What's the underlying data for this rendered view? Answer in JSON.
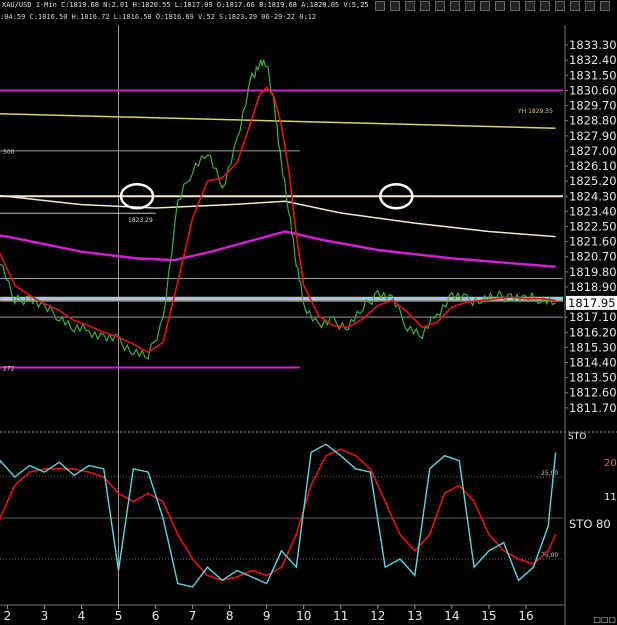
{
  "toolbar": {
    "header": "XAU/USD  1-Min  C:1819.68  N:2.01  H:1820.55  L:1817.09  O:1817.66  B:1819.68  A:1820.05  V:5,25",
    "icons": [
      "wave-icon",
      "check-icon",
      "bars-icon",
      "down-arrow-icon",
      "stop-icon",
      "zoom-icon",
      "pencil-icon",
      "pencil-icon",
      "flag-icon",
      "question-icon",
      "help-icon",
      "pencil-icon",
      "box-icon",
      "crosshair-icon",
      "grid-icon",
      "window-icon"
    ]
  },
  "info_line": ":04:59  C:1816.50  H:1816.72  L:1816.50  O:1816.69  V:52  S:1823.29  06-29-22  0:12",
  "right_boxes": "□□□",
  "colors": {
    "background": "#000000",
    "price": "#3fae3f",
    "price_ma": "#e01515",
    "magenta": "#d020d0",
    "yellow": "#d8d26a",
    "cream": "#f2e9c8",
    "light_blue": "#9cc8e8",
    "orange": "#e0702a",
    "cyan": "#5fd4e0",
    "label_box": "#ffffff"
  },
  "chart_data": {
    "type": "line",
    "symbol": "XAU/USD 1-Min",
    "price_panel": {
      "ylim": [
        1810.5,
        1834.2
      ],
      "ytick_labels": [
        "1833.30",
        "1832.40",
        "1831.50",
        "1830.60",
        "1829.70",
        "1828.80",
        "1827.90",
        "1827.00",
        "1826.10",
        "1825.20",
        "1824.30",
        "1823.40",
        "1822.50",
        "1821.60",
        "1820.70",
        "1819.80",
        "1818.90",
        "1817.10",
        "1816.20",
        "1815.30",
        "1814.40",
        "1813.50",
        "1812.60",
        "1811.70"
      ],
      "current_price_label": "1817.95",
      "current_price": 1817.95,
      "price_series": {
        "x": [
          1.4,
          1.8,
          2.2,
          2.6,
          3.0,
          3.4,
          3.8,
          4.2,
          4.6,
          5.0,
          5.4,
          5.8,
          6.2,
          6.6,
          7.0,
          7.4,
          7.8,
          8.2,
          8.6,
          8.8,
          9.0,
          9.2,
          9.4,
          9.6,
          9.8,
          10.0,
          10.4,
          10.8,
          11.2,
          11.6,
          12.0,
          12.4,
          12.8,
          13.2,
          13.6,
          14.0,
          14.4,
          14.8,
          15.2,
          15.6,
          16.0,
          16.4,
          16.8
        ],
        "values": [
          1822.3,
          1820.5,
          1818.0,
          1818.3,
          1817.6,
          1817.2,
          1816.4,
          1816.3,
          1815.9,
          1815.7,
          1815.1,
          1814.7,
          1817.0,
          1823.8,
          1826.0,
          1826.9,
          1824.8,
          1827.6,
          1831.3,
          1832.3,
          1832.1,
          1829.9,
          1826.0,
          1823.6,
          1820.3,
          1817.9,
          1816.6,
          1816.8,
          1816.6,
          1817.6,
          1818.6,
          1818.1,
          1816.6,
          1816.0,
          1817.3,
          1818.4,
          1818.1,
          1818.2,
          1818.3,
          1818.4,
          1818.1,
          1818.3,
          1817.95
        ]
      },
      "price_ma_series": {
        "x": [
          1.4,
          1.8,
          2.2,
          2.6,
          3.0,
          3.4,
          3.8,
          4.2,
          4.6,
          5.0,
          5.4,
          5.8,
          6.2,
          6.6,
          7.0,
          7.4,
          7.8,
          8.2,
          8.6,
          8.8,
          9.0,
          9.2,
          9.4,
          9.6,
          9.8,
          10.0,
          10.4,
          10.8,
          11.2,
          11.6,
          12.0,
          12.4,
          12.8,
          13.2,
          13.6,
          14.0,
          14.4,
          14.8,
          15.2,
          15.6,
          16.0,
          16.4,
          16.8
        ],
        "values": [
          1821.8,
          1820.9,
          1819.0,
          1818.4,
          1817.9,
          1817.5,
          1816.9,
          1816.6,
          1816.2,
          1815.9,
          1815.5,
          1815.0,
          1815.6,
          1819.2,
          1823.0,
          1825.2,
          1825.4,
          1826.3,
          1828.9,
          1830.3,
          1830.8,
          1830.2,
          1828.5,
          1825.8,
          1822.0,
          1819.0,
          1817.2,
          1816.6,
          1816.5,
          1817.0,
          1817.8,
          1818.1,
          1817.4,
          1816.5,
          1816.8,
          1817.7,
          1818.0,
          1818.1,
          1818.2,
          1818.3,
          1818.2,
          1818.2,
          1818.1
        ]
      },
      "horizontal_levels": [
        {
          "value": 1830.6,
          "color": "magenta",
          "label": ""
        },
        {
          "value": 1827.0,
          "color": "gray",
          "label": "500",
          "x_end": 9.9
        },
        {
          "value": 1824.3,
          "color": "cream",
          "label": ""
        },
        {
          "value": 1823.29,
          "color": "lightgray",
          "label": "1823.29",
          "x_end": 6.0
        },
        {
          "value": 1818.2,
          "color": "light_blue",
          "label": "000"
        },
        {
          "value": 1818.05,
          "color": "orange",
          "label": ""
        },
        {
          "value": 1814.1,
          "color": "magenta",
          "label": "272",
          "x_end": 9.9
        },
        {
          "value": 1817.1,
          "color": "gray",
          "label": ""
        },
        {
          "value": 1819.4,
          "color": "gray",
          "label": ""
        }
      ],
      "sloping_levels": [
        {
          "color": "yellow",
          "label": "YH 1829.35",
          "x": [
            0.3,
            16.8
          ],
          "values": [
            1829.3,
            1828.35
          ]
        },
        {
          "color": "cream",
          "label": "",
          "x": [
            0.3,
            4.0,
            6.0,
            8.0,
            9.5,
            11.0,
            13.0,
            15.0,
            16.8
          ],
          "values": [
            1824.7,
            1823.8,
            1823.6,
            1823.8,
            1824.0,
            1823.3,
            1822.7,
            1822.2,
            1821.9
          ]
        },
        {
          "color": "magenta",
          "label": "",
          "x": [
            0.3,
            2.0,
            4.0,
            5.5,
            6.5,
            7.5,
            8.5,
            9.5,
            10.5,
            12.0,
            14.0,
            16.8
          ],
          "values": [
            1822.3,
            1821.9,
            1821.0,
            1820.6,
            1820.5,
            1821.0,
            1821.6,
            1822.2,
            1821.7,
            1821.1,
            1820.6,
            1820.1
          ]
        }
      ],
      "markers": [
        {
          "type": "circle",
          "x": 5.5,
          "value": 1824.3
        },
        {
          "type": "circle",
          "x": 12.5,
          "value": 1824.3
        }
      ]
    },
    "oscillator_panel": {
      "label": "STO",
      "right_labels": [
        "STO  80",
        "11",
        "20"
      ],
      "level_labels": [
        "25.00",
        "75.00"
      ],
      "ylim": [
        0,
        100
      ],
      "levels": [
        25,
        50,
        75
      ],
      "fast_series": {
        "x": [
          1.4,
          1.8,
          2.2,
          2.6,
          3.0,
          3.4,
          3.8,
          4.2,
          4.6,
          5.0,
          5.4,
          5.8,
          6.2,
          6.6,
          7.0,
          7.4,
          7.8,
          8.2,
          8.6,
          9.0,
          9.4,
          9.8,
          10.2,
          10.6,
          11.0,
          11.4,
          11.8,
          12.2,
          12.6,
          13.0,
          13.4,
          13.8,
          14.2,
          14.6,
          15.0,
          15.4,
          15.8,
          16.2,
          16.6,
          16.8
        ],
        "values": [
          20,
          85,
          75,
          82,
          78,
          84,
          76,
          82,
          80,
          18,
          80,
          78,
          50,
          10,
          8,
          20,
          12,
          18,
          14,
          10,
          30,
          20,
          90,
          95,
          88,
          80,
          78,
          20,
          25,
          15,
          80,
          88,
          85,
          20,
          30,
          35,
          12,
          20,
          45,
          90
        ]
      },
      "slow_series": {
        "x": [
          1.4,
          1.8,
          2.2,
          2.6,
          3.0,
          3.4,
          3.8,
          4.2,
          4.6,
          5.0,
          5.4,
          5.8,
          6.2,
          6.6,
          7.0,
          7.4,
          7.8,
          8.2,
          8.6,
          9.0,
          9.4,
          9.8,
          10.2,
          10.6,
          11.0,
          11.4,
          11.8,
          12.2,
          12.6,
          13.0,
          13.4,
          13.8,
          14.2,
          14.6,
          15.0,
          15.4,
          15.8,
          16.2,
          16.6,
          16.8
        ],
        "values": [
          15,
          50,
          70,
          78,
          80,
          80,
          80,
          78,
          75,
          65,
          60,
          65,
          60,
          40,
          25,
          15,
          12,
          14,
          18,
          15,
          20,
          40,
          70,
          88,
          92,
          88,
          80,
          60,
          40,
          30,
          40,
          65,
          70,
          60,
          40,
          30,
          25,
          22,
          30,
          40
        ]
      }
    },
    "x_axis": {
      "tick_values": [
        2,
        3,
        4,
        5,
        6,
        7,
        8,
        9,
        10,
        11,
        12,
        13,
        14,
        15,
        16
      ],
      "tick_labels": [
        "2",
        "3",
        "4",
        "5",
        "6",
        "7",
        "8",
        "9",
        "10",
        "11",
        "12",
        "13",
        "14",
        "15",
        "16"
      ],
      "xlim": [
        1.8,
        17.0
      ],
      "crosshair_x": 5.0
    },
    "grid": false
  }
}
